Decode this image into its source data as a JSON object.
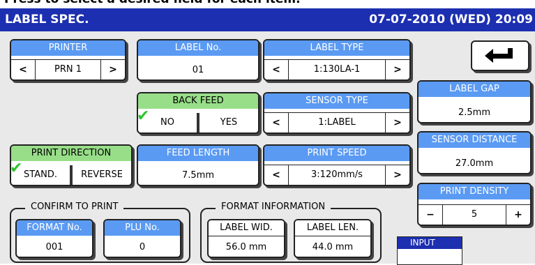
{
  "caption": "Press to select a desired field for each item.",
  "title": "LABEL SPEC.",
  "datetime": "07-07-2010 (WED)  20:09",
  "printer": {
    "label": "PRINTER",
    "value": "PRN 1",
    "prev": "<",
    "next": ">"
  },
  "label_no": {
    "label": "LABEL No.",
    "value": "01"
  },
  "label_type": {
    "label": "LABEL TYPE",
    "value": "1:130LA-1",
    "prev": "<",
    "next": ">"
  },
  "back_feed": {
    "label": "BACK FEED",
    "no": "NO",
    "yes": "YES",
    "selected": "NO"
  },
  "sensor_type": {
    "label": "SENSOR TYPE",
    "value": "1:LABEL",
    "prev": "<",
    "next": ">"
  },
  "label_gap": {
    "label": "LABEL GAP",
    "value": "2.5mm"
  },
  "sensor_distance": {
    "label": "SENSOR DISTANCE",
    "value": "27.0mm"
  },
  "print_direction": {
    "label": "PRINT DIRECTION",
    "stand": "STAND.",
    "reverse": "REVERSE",
    "selected": "STAND."
  },
  "feed_length": {
    "label": "FEED LENGTH",
    "value": "7.5mm"
  },
  "print_speed": {
    "label": "PRINT SPEED",
    "value": "3:120mm/s",
    "prev": "<",
    "next": ">"
  },
  "print_density": {
    "label": "PRINT DENSITY",
    "value": "5",
    "minus": "−",
    "plus": "+"
  },
  "confirm_to_print": {
    "label": "CONFIRM TO PRINT",
    "format_no_label": "FORMAT No.",
    "format_no": "001",
    "plu_no_label": "PLU No.",
    "plu_no": "0"
  },
  "format_information": {
    "label": "FORMAT INFORMATION",
    "label_wid_label": "LABEL WID.",
    "label_wid": "56.0 mm",
    "label_len_label": "LABEL LEN.",
    "label_len": "44.0 mm"
  },
  "input": {
    "label": "INPUT",
    "value": ""
  },
  "colors": {
    "title_bar": "#1c2fb0",
    "header_blue": "#5a9af3",
    "header_green": "#98de89",
    "check": "#2cc52c",
    "background": "#e9e9e9"
  }
}
